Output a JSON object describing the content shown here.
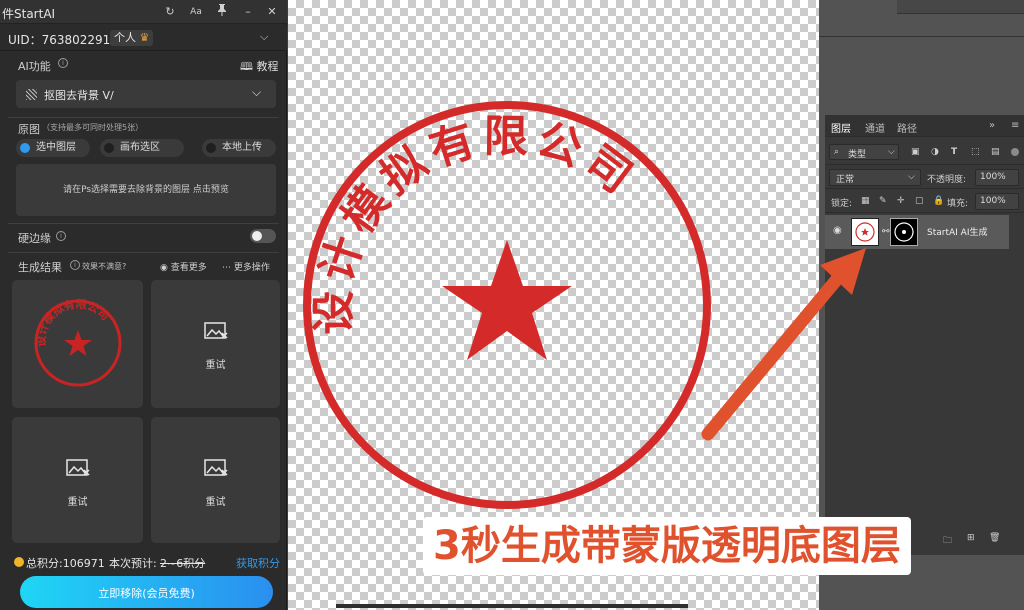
{
  "plugin": {
    "title": "件StartAI",
    "uid_label": "UID：763802291",
    "account_type": "个人",
    "ai_function_label": "AI功能",
    "tutorial_label": "教程",
    "selected_function": "抠图去背景 V/",
    "source_label": "原图",
    "source_hint": "（支持最多可同时处理5张）",
    "source_options": [
      "选中图层",
      "画布选区",
      "本地上传"
    ],
    "source_selected": "选中图层",
    "preview_hint": "请在Ps选择需要去除背景的图层 点击预览",
    "hard_edge_label": "硬边缘",
    "hard_edge_on": false,
    "results_label": "生成结果",
    "unsatisfied_label": "效果不满意?",
    "view_more_label": "查看更多",
    "more_ops_label": "更多操作",
    "retry_label": "重试",
    "total_points": "总积分:106971",
    "estimate_label": "本次预计:",
    "estimate_value": "2~6积分",
    "get_points_label": "获取积分",
    "remove_button": "立即移除(会员免费)"
  },
  "stamp": {
    "text": "设计模拟有限公司",
    "color": "#d42a2a"
  },
  "caption": "3秒生成带蒙版透明底图层",
  "layers_panel": {
    "tabs": [
      "图层",
      "通道",
      "路径"
    ],
    "active_tab": "图层",
    "filter_kind": "类型",
    "blend_mode": "正常",
    "opacity_label": "不透明度:",
    "opacity_value": "100%",
    "lock_label": "锁定:",
    "fill_label": "填充:",
    "fill_value": "100%",
    "layer_name": "StartAI AI生成"
  },
  "colors": {
    "accent_blue": "#2f9bf0",
    "stamp_red": "#d42a2a",
    "arrow_orange": "#e0512e",
    "points_link": "#2f9bf0",
    "remove_button_gradient": [
      "#1fd6f5",
      "#2a8ff0"
    ]
  }
}
